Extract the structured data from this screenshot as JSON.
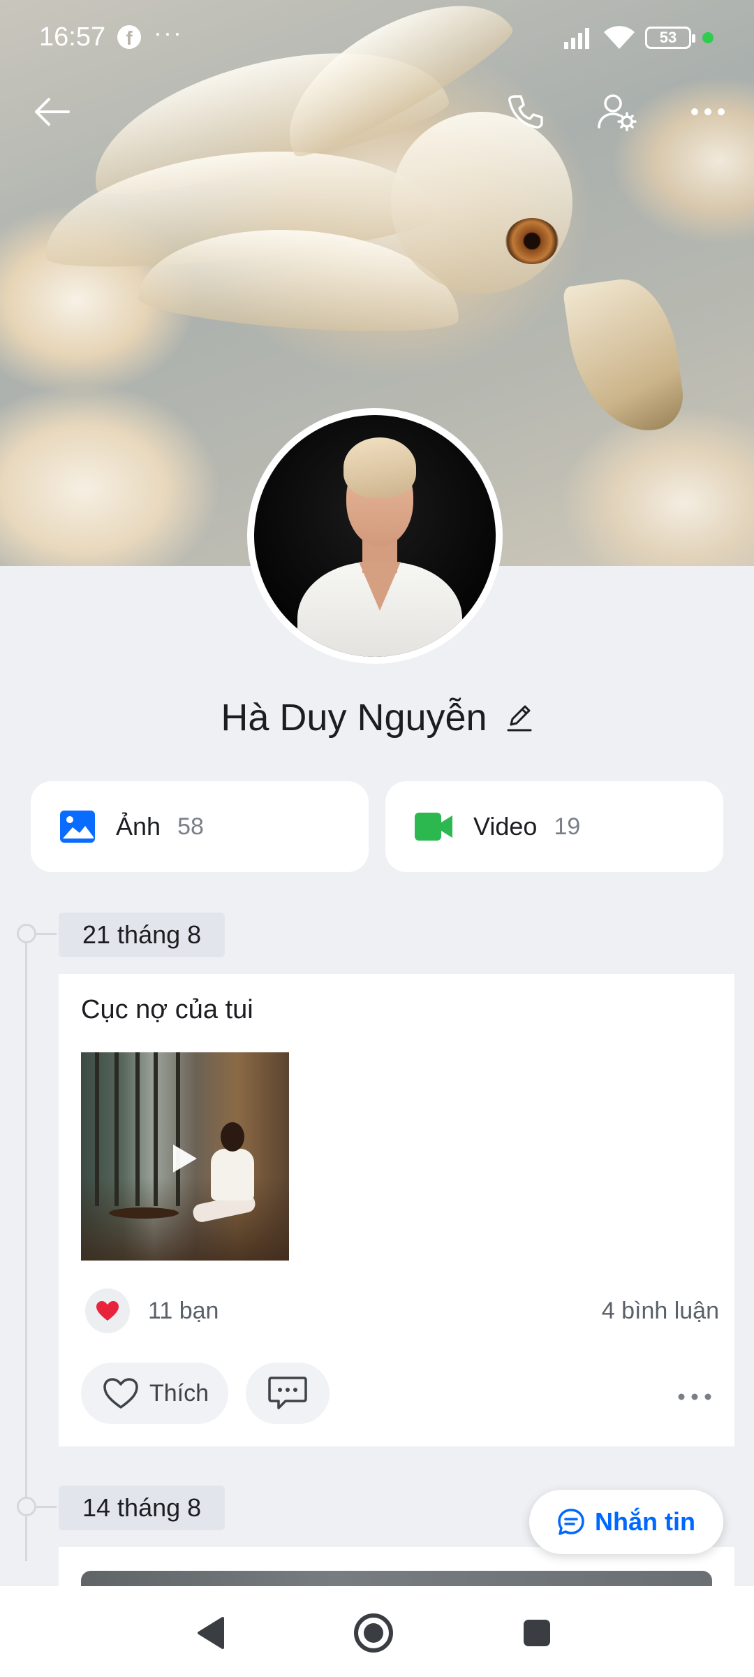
{
  "status_bar": {
    "time": "16:57",
    "more": "···",
    "battery": "53",
    "fb_letter": "f"
  },
  "header": {
    "back_icon": "back-arrow-icon",
    "call_icon": "phone-icon",
    "settings_icon": "user-settings-icon",
    "more_icon": "more-icon"
  },
  "profile": {
    "name": "Hà Duy Nguyễn"
  },
  "media": {
    "photos": {
      "label": "Ảnh",
      "count": "58",
      "color": "#0a6cff"
    },
    "videos": {
      "label": "Video",
      "count": "19",
      "color": "#2cb84f"
    }
  },
  "timeline": [
    {
      "date": "21 tháng 8",
      "caption": "Cục nợ của tui",
      "reactions": "11 bạn",
      "comments": "4 bình luận",
      "like_label": "Thích"
    },
    {
      "date": "14 tháng 8"
    }
  ],
  "message_button": {
    "label": "Nhắn tin",
    "color": "#0068ff"
  },
  "navbar": {
    "back": "nav-back-icon",
    "home": "nav-home-icon",
    "recents": "nav-recents-icon"
  }
}
